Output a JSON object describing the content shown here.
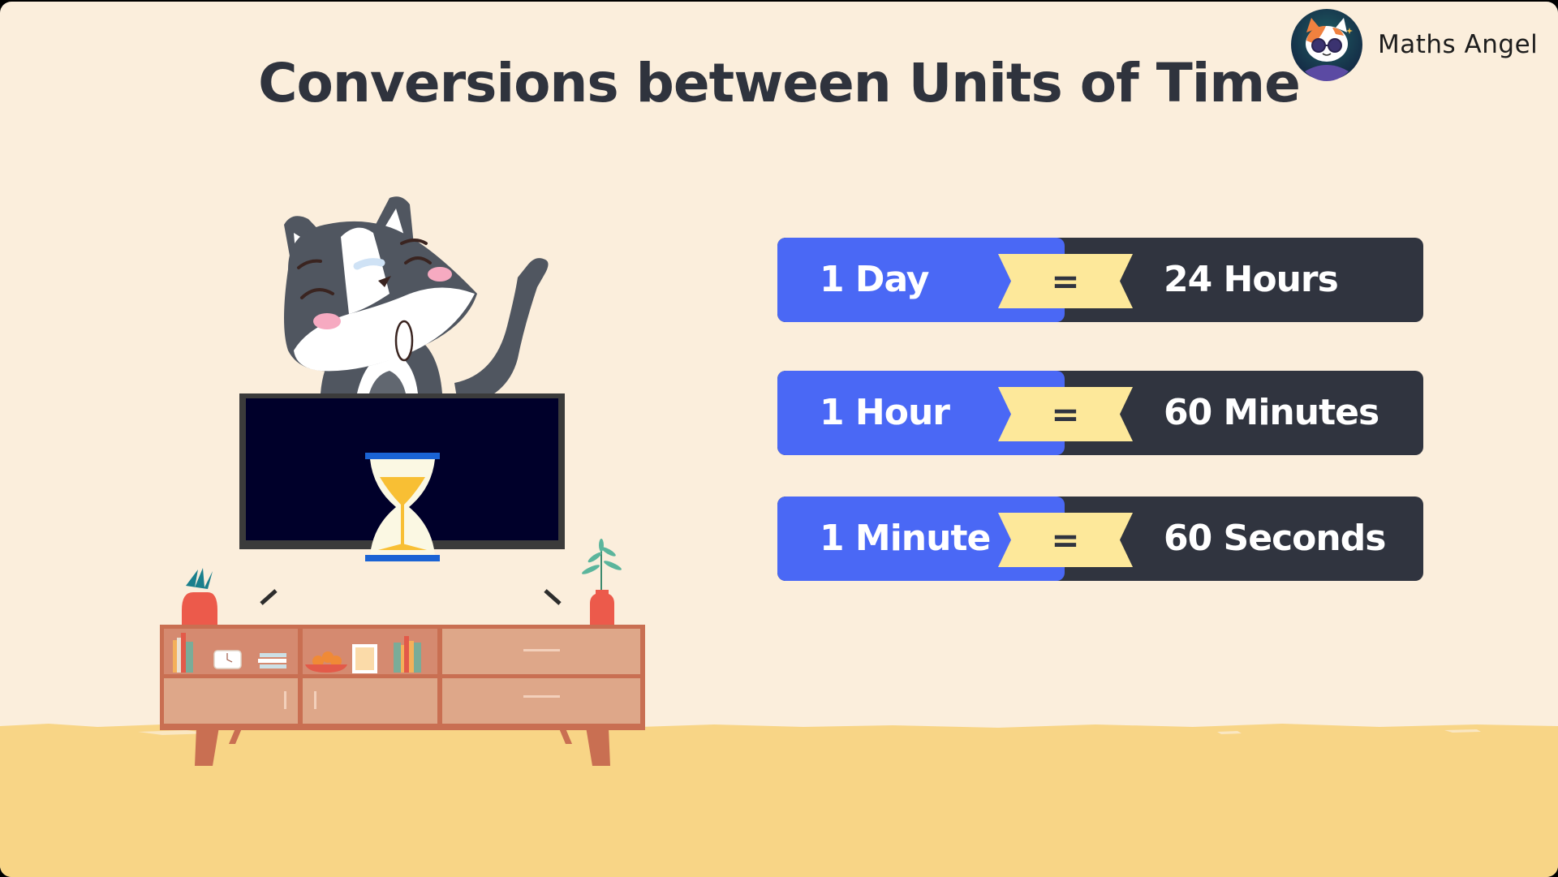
{
  "slide": {
    "title": "Conversions between Units of Time",
    "brand": {
      "name": "Maths Angel",
      "logo_icon": "cat-with-sunglasses-avatar-icon"
    },
    "conversions": [
      {
        "lhs": "1 Day",
        "operator": "=",
        "rhs": "24 Hours"
      },
      {
        "lhs": "1 Hour",
        "operator": "=",
        "rhs": "60 Minutes"
      },
      {
        "lhs": "1 Minute",
        "operator": "=",
        "rhs": "60 Seconds"
      }
    ],
    "illustration": {
      "character": "waving-grey-cat-icon",
      "tv_screen_icon": "hourglass-icon",
      "furniture": "tv-cabinet-icon"
    },
    "colors": {
      "background": "#fbeedc",
      "floor": "#f8d586",
      "title": "#2f333d",
      "card_left": "#4a68f5",
      "card_right": "#30343f",
      "equals_badge": "#fde89a"
    }
  }
}
